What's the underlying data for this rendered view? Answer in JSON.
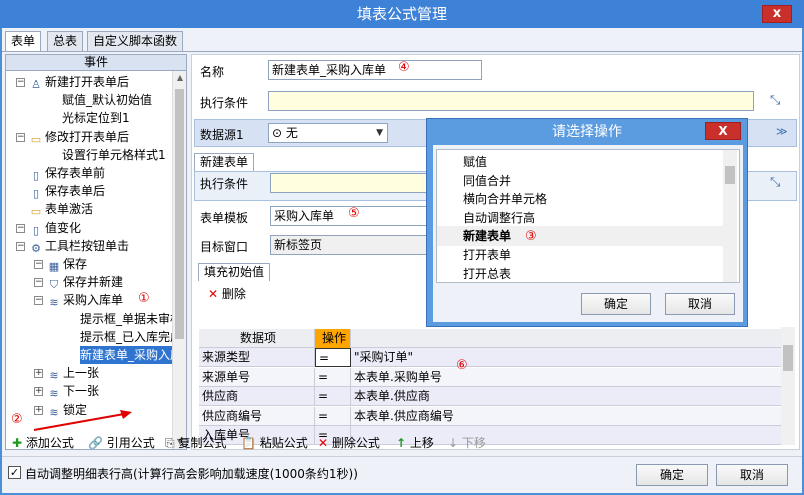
{
  "window": {
    "title": "填表公式管理",
    "close": "x"
  },
  "tabs": [
    "表单",
    "总表",
    "自定义脚本函数"
  ],
  "left": {
    "header": "事件",
    "nodes": [
      {
        "label": "新建打开表单后",
        "icon": "person-icon"
      },
      {
        "label": "赋值_默认初始值"
      },
      {
        "label": "光标定位到1"
      },
      {
        "label": "修改打开表单后",
        "icon": "folder-icon"
      },
      {
        "label": "设置行单元格样式1"
      },
      {
        "label": "保存表单前",
        "icon": "doc-icon"
      },
      {
        "label": "保存表单后",
        "icon": "doc-icon"
      },
      {
        "label": "表单激活",
        "icon": "folder-icon"
      },
      {
        "label": "值变化",
        "icon": "doc-icon"
      },
      {
        "label": "工具栏按钮单击",
        "icon": "gear-icon"
      },
      {
        "label": "保存",
        "icon": "save-icon"
      },
      {
        "label": "保存并新建",
        "icon": "shield-icon"
      },
      {
        "label": "采购入库单",
        "icon": "layers-icon"
      },
      {
        "label": "提示框_单据未审核"
      },
      {
        "label": "提示框_已入库完成"
      },
      {
        "label": "新建表单_采购入库"
      },
      {
        "label": "上一张",
        "icon": "layers-icon"
      },
      {
        "label": "下一张",
        "icon": "layers-icon"
      },
      {
        "label": "锁定",
        "icon": "layers-icon"
      }
    ]
  },
  "circles": {
    "c1": "①",
    "c2": "②",
    "c3": "③",
    "c4": "④",
    "c5": "⑤",
    "c6": "⑥"
  },
  "form": {
    "name_label": "名称",
    "name_value": "新建表单_采购入库单",
    "cond_label": "执行条件",
    "datasource_label": "数据源1",
    "datasource_value": "无",
    "datasource_symbol": "⊙"
  },
  "sub": {
    "tab": "新建表单",
    "cond_label": "执行条件",
    "template_label": "表单模板",
    "template_value": "采购入库单",
    "target_label": "目标窗口",
    "target_value": "新标签页",
    "fill_tab": "填充初始值",
    "delete": "删除"
  },
  "grid": {
    "headers": [
      "数据项",
      "操作",
      ""
    ],
    "rows": [
      [
        "来源类型",
        "=",
        "\"采购订单\""
      ],
      [
        "来源单号",
        "=",
        "本表单.采购单号"
      ],
      [
        "供应商",
        "=",
        "本表单.供应商"
      ],
      [
        "供应商编号",
        "=",
        "本表单.供应商编号"
      ],
      [
        "入库单号",
        "=",
        ""
      ]
    ]
  },
  "dialog": {
    "title": "请选择操作",
    "close": "X",
    "items": [
      "赋值",
      "同值合并",
      "横向合并单元格",
      "自动调整行高",
      "新建表单",
      "打开表单",
      "打开总表"
    ],
    "ok": "确定",
    "cancel": "取消"
  },
  "toolbar": {
    "add": "添加公式",
    "ref": "引用公式",
    "copy": "复制公式",
    "paste": "粘贴公式",
    "del": "删除公式",
    "up": "上移",
    "down": "下移"
  },
  "bottom": {
    "checkbox": "自动调整明细表行高(计算行高会影响加载速度(1000条约1秒))",
    "ok": "确定",
    "cancel": "取消"
  },
  "colors": {
    "title": "#3d82d6",
    "selection": "#2f74d0",
    "highlight": "#e00000"
  }
}
